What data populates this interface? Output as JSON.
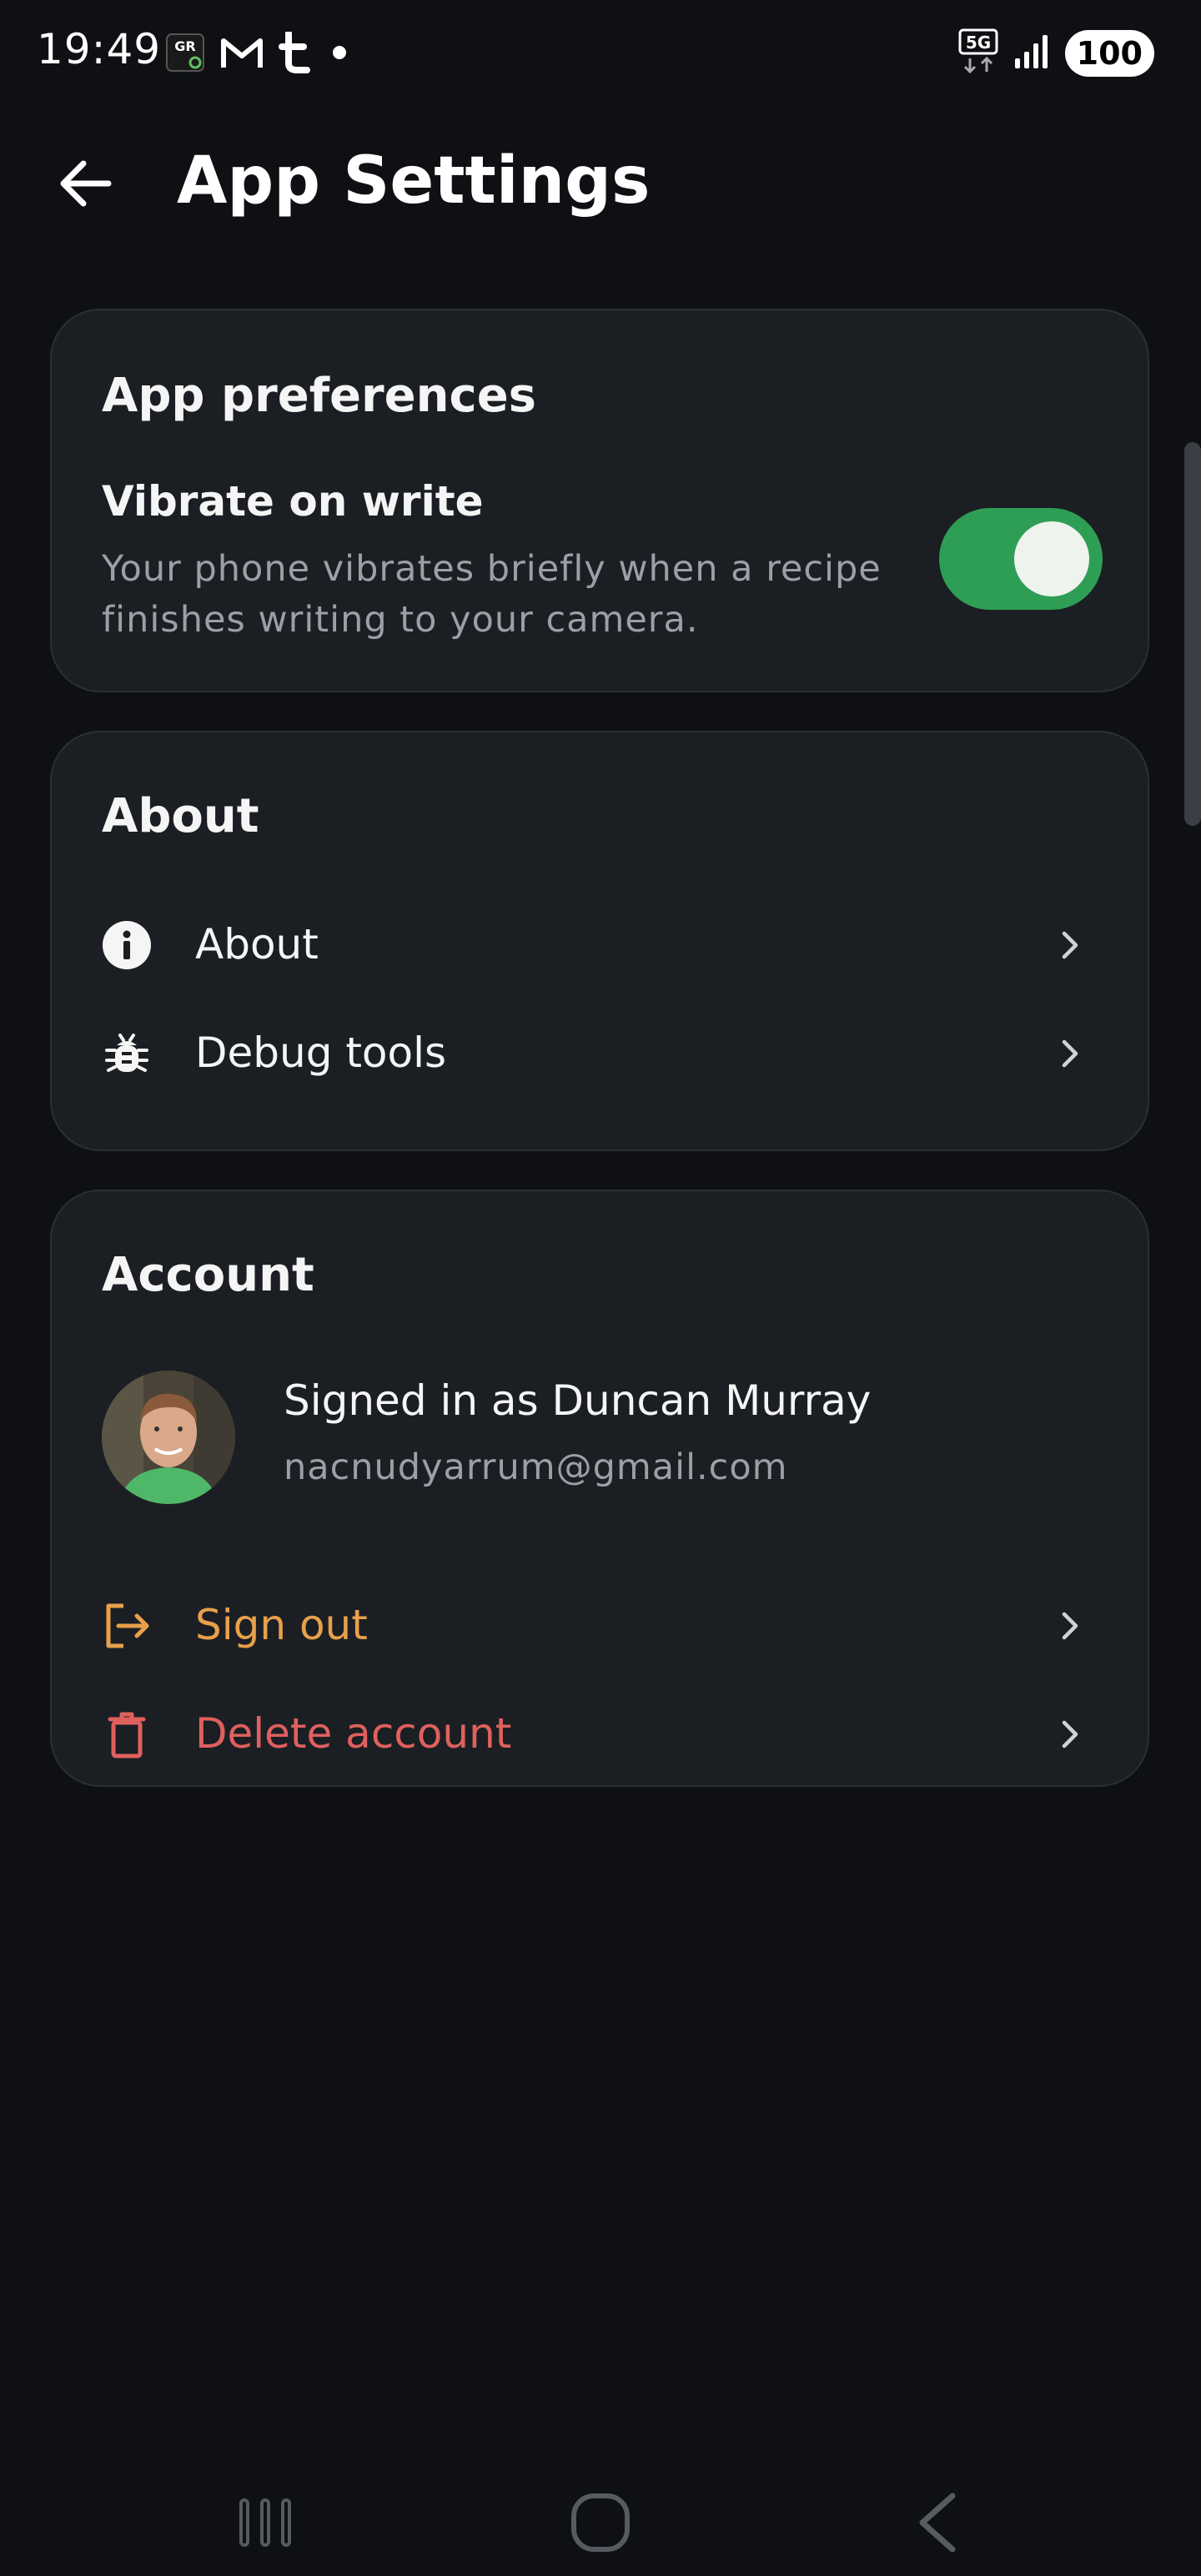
{
  "status_bar": {
    "time": "19:49",
    "notification_icons": [
      "gr-app-icon",
      "gmail-icon",
      "tumblr-icon",
      "dot-icon"
    ],
    "network": "5G",
    "battery": "100"
  },
  "header": {
    "title": "App Settings",
    "back_icon": "arrow-back-icon"
  },
  "preferences": {
    "title": "App preferences",
    "vibrate": {
      "label": "Vibrate on write",
      "description": "Your phone vibrates briefly when a recipe finishes writing to your camera.",
      "enabled": true
    }
  },
  "about_section": {
    "title": "About",
    "items": [
      {
        "label": "About",
        "icon": "info-icon"
      },
      {
        "label": "Debug tools",
        "icon": "bug-icon"
      }
    ]
  },
  "account": {
    "title": "Account",
    "signed_in_text": "Signed in as Duncan Murray",
    "email": "nacnudyarrum@gmail.com",
    "sign_out": {
      "label": "Sign out",
      "icon": "logout-icon",
      "color": "#e8a04a"
    },
    "delete": {
      "label": "Delete account",
      "icon": "trash-icon",
      "color": "#e0605e"
    }
  },
  "colors": {
    "background": "#0e1013",
    "card": "#1b1f23",
    "toggle_on": "#2f9e55",
    "secondary_text": "#9aa0a6"
  },
  "nav_bar": {
    "buttons": [
      "recent-apps-icon",
      "home-icon",
      "back-nav-icon"
    ]
  }
}
